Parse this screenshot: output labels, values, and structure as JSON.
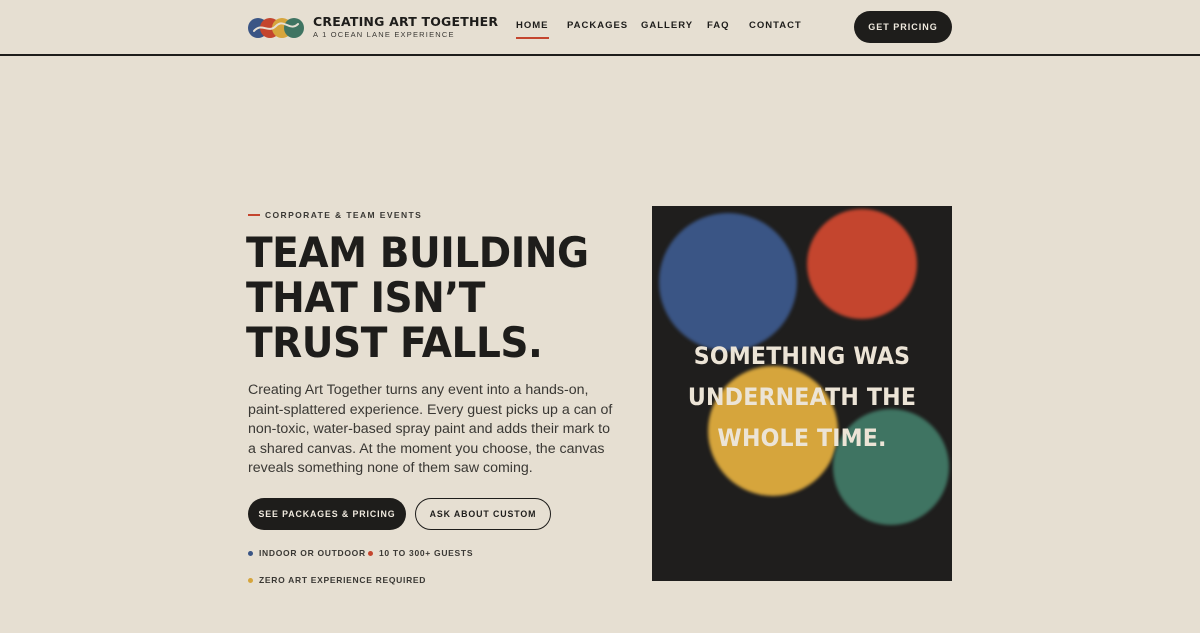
{
  "brand": {
    "title": "CREATING ART TOGETHER",
    "subtitle": "A 1 OCEAN LANE EXPERIENCE",
    "logo_colors": [
      "#3a5585",
      "#c4452e",
      "#d6a53c",
      "#3f7462"
    ]
  },
  "nav": {
    "items": [
      {
        "label": "HOME",
        "active": true
      },
      {
        "label": "PACKAGES",
        "active": false
      },
      {
        "label": "GALLERY",
        "active": false
      },
      {
        "label": "FAQ",
        "active": false
      },
      {
        "label": "CONTACT",
        "active": false
      }
    ],
    "cta_label": "GET PRICING"
  },
  "hero": {
    "eyebrow": "CORPORATE & TEAM EVENTS",
    "headline_lines": [
      "TEAM BUILDING",
      "THAT ISN’T",
      "TRUST FALLS."
    ],
    "body": "Creating Art Together turns any event into a hands-on, paint-splattered experience. Every guest picks up a can of non-toxic, water-based spray paint and adds their mark to a shared canvas. At the moment you choose, the canvas reveals something none of them saw coming.",
    "primary_button": "SEE PACKAGES & PRICING",
    "secondary_button": "ASK ABOUT CUSTOM",
    "features": [
      {
        "label": "INDOOR OR OUTDOOR",
        "color": "#3a5585"
      },
      {
        "label": "10 TO 300+ GUESTS",
        "color": "#c4452e"
      },
      {
        "label": "ZERO ART EXPERIENCE REQUIRED",
        "color": "#d6a53c"
      }
    ]
  },
  "art_panel": {
    "lines": [
      "SOMETHING WAS",
      "UNDERNEATH THE",
      "WHOLE TIME."
    ],
    "background": "#1f1e1d",
    "blob_colors": [
      "#3a5585",
      "#c4452e",
      "#d6a53c",
      "#3f7462"
    ]
  }
}
